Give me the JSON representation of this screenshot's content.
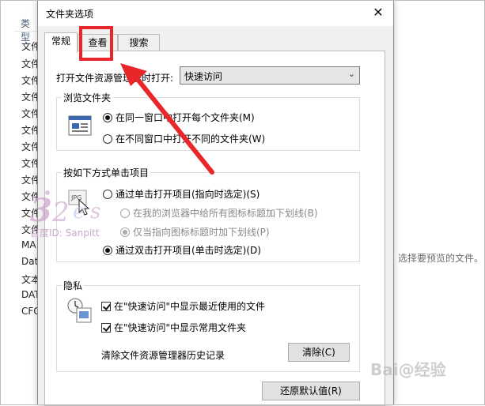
{
  "background": {
    "column_header": "类型",
    "list_items": [
      "文件",
      "文件",
      "文件",
      "文件",
      "文件",
      "文件",
      "文件",
      "文件",
      "文件",
      "文件",
      "文件",
      "文件",
      "MA",
      "Dat",
      "文本",
      "DAT",
      "CFG"
    ],
    "preview_text": "选择要预览的文件。"
  },
  "dialog": {
    "title": "文件夹选项",
    "close_glyph": "✕",
    "tabs": [
      {
        "label": "常规"
      },
      {
        "label": "查看"
      },
      {
        "label": "搜索"
      }
    ],
    "open_in_label": "打开文件资源管理器时打开:",
    "open_in_value": "快速访问",
    "browse_group": {
      "title": "浏览文件夹",
      "options": [
        {
          "label": "在同一窗口中打开每个文件夹(M)",
          "checked": true
        },
        {
          "label": "在不同窗口中打开不同的文件夹(W)",
          "checked": false
        }
      ]
    },
    "click_group": {
      "title": "按如下方式单击项目",
      "options": [
        {
          "label": "通过单击打开项目(指向时选定)(S)",
          "checked": false
        },
        {
          "label": "在我的浏览器中给所有图标标题加下划线(B)",
          "checked": false
        },
        {
          "label": "仅当指向图标标题时加下划线(P)",
          "checked": true
        },
        {
          "label": "通过双击打开项目(单击时选定)(D)",
          "checked": true
        }
      ]
    },
    "privacy_group": {
      "title": "隐私",
      "checks": [
        {
          "label": "在\"快速访问\"中显示最近使用的文件",
          "checked": true
        },
        {
          "label": "在\"快速访问\"中显示常用文件夹",
          "checked": true
        }
      ],
      "clear_label": "清除文件资源管理器历史记录",
      "clear_button": "清除(C)"
    },
    "restore_button": "还原默认值(R)"
  },
  "watermark": {
    "id_text": "百度ID: Sanpitt",
    "site_text": "Bai@经验"
  },
  "colors": {
    "highlight": "#e8272b",
    "dialog_bg": "#f0f0f0",
    "panel_bg": "#ffffff"
  }
}
